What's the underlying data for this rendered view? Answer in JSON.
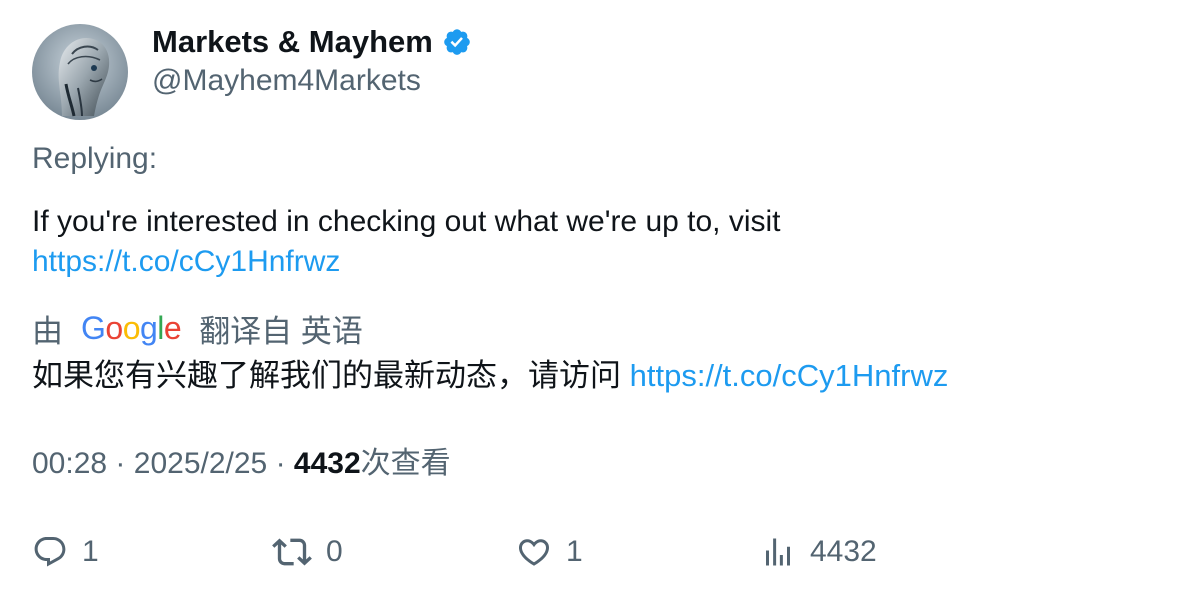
{
  "author": {
    "display_name": "Markets & Mayhem",
    "handle": "@Mayhem4Markets",
    "verified": true,
    "avatar_icon": "robot-avatar-icon"
  },
  "tweet": {
    "replying_label": "Replying:",
    "text": "If you're interested in checking out what we're up to, visit",
    "link": "https://t.co/cCy1Hnfrwz"
  },
  "translation": {
    "by_label": "由",
    "provider": "Google",
    "translated_from_label": "翻译自 英语",
    "text": "如果您有兴趣了解我们的最新动态，请访问",
    "link": "https://t.co/cCy1Hnfrwz"
  },
  "meta": {
    "time": "00:28",
    "separator": "·",
    "date": "2025/2/25",
    "views_count": "4432",
    "views_label": "次查看"
  },
  "actions": {
    "reply_count": "1",
    "retweet_count": "0",
    "like_count": "1",
    "views_count": "4432"
  },
  "colors": {
    "link": "#1d9bf0",
    "secondary_text": "#536471",
    "primary_text": "#0f1419",
    "verified_badge": "#1d9bf0"
  }
}
